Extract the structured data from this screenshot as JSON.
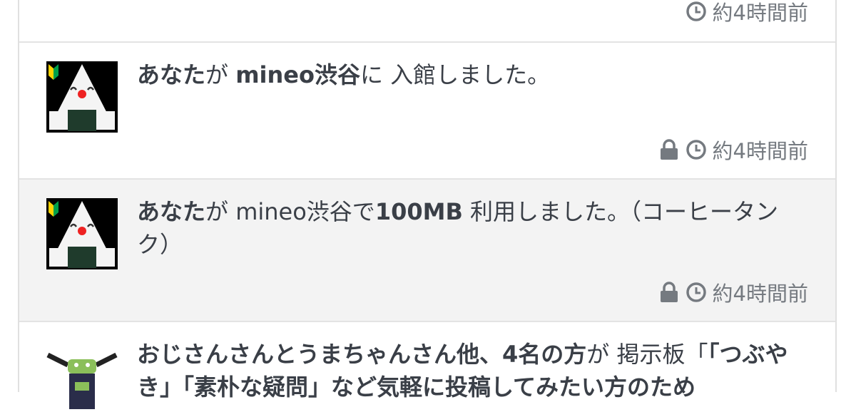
{
  "feed": {
    "top_item": {
      "time": "約4時間前"
    },
    "items": [
      {
        "actor": "あなた",
        "particle1": "が ",
        "place": "mineo渋谷",
        "rest": "に 入館しました。",
        "time": "約4時間前"
      },
      {
        "actor": "あなた",
        "particle1": "が mineo渋谷で",
        "amount": "100MB",
        "rest": " 利用しました。（コーヒータンク）",
        "time": "約4時間前"
      },
      {
        "actor": "おじさんさんとうまちゃんさん他、4名の方",
        "particle1": "が 掲示板「",
        "topic": "「つぶやき」「素朴な疑問」など気軽に投稿してみたい方のため"
      }
    ]
  },
  "icons": {
    "lock": "lock-icon",
    "clock": "clock-icon"
  },
  "colors": {
    "text": "#3a3f47",
    "meta": "#757a80",
    "highlight_row": "#f3f3f3",
    "border": "#e3e3e3"
  }
}
